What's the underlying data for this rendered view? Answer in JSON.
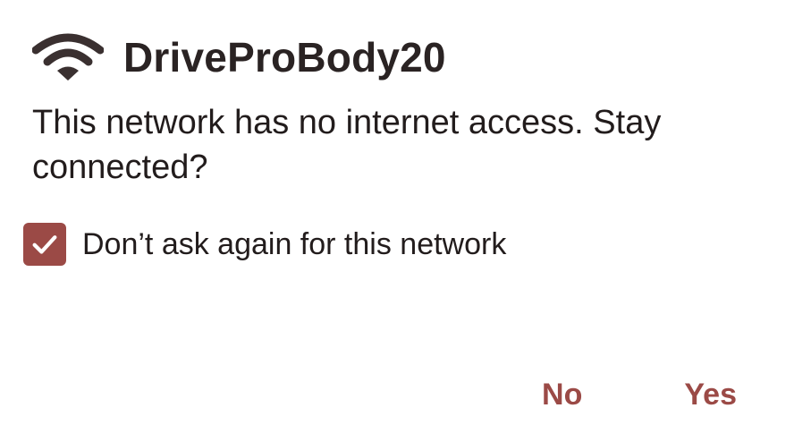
{
  "dialog": {
    "title": "DriveProBody20",
    "icon": "wifi-icon",
    "message": "This network has no internet access. Stay connected?",
    "checkbox": {
      "label": "Don’t ask again for this network",
      "checked": true,
      "icon": "checkmark-icon"
    },
    "buttons": {
      "no_label": "No",
      "yes_label": "Yes"
    }
  },
  "colors": {
    "accent": "#9b4a46",
    "title_text": "#2a2323",
    "body_text": "#221c1c",
    "background": "#ffffff"
  }
}
